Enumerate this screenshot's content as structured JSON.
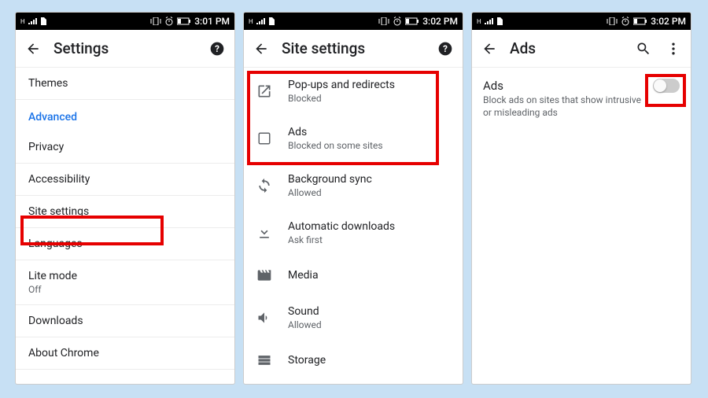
{
  "statusNetworkLabel": "H",
  "phone1": {
    "time": "3:01 PM",
    "title": "Settings",
    "items": {
      "themes": "Themes",
      "advanced": "Advanced",
      "privacy": "Privacy",
      "accessibility": "Accessibility",
      "siteSettings": "Site settings",
      "languages": "Languages",
      "liteMode": "Lite mode",
      "liteModeSub": "Off",
      "downloads": "Downloads",
      "aboutChrome": "About Chrome"
    }
  },
  "phone2": {
    "time": "3:02 PM",
    "title": "Site settings",
    "items": {
      "popups": {
        "title": "Pop-ups and redirects",
        "sub": "Blocked"
      },
      "ads": {
        "title": "Ads",
        "sub": "Blocked on some sites"
      },
      "bgSync": {
        "title": "Background sync",
        "sub": "Allowed"
      },
      "autoDl": {
        "title": "Automatic downloads",
        "sub": "Ask first"
      },
      "media": {
        "title": "Media"
      },
      "sound": {
        "title": "Sound",
        "sub": "Allowed"
      },
      "storage": {
        "title": "Storage"
      }
    }
  },
  "phone3": {
    "time": "3:02 PM",
    "title": "Ads",
    "ads": {
      "title": "Ads",
      "sub": "Block ads on sites that show intrusive or misleading ads"
    }
  }
}
